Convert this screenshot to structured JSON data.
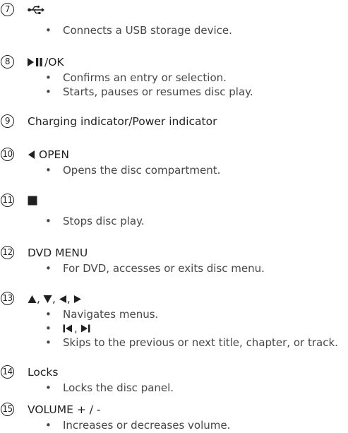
{
  "items": [
    {
      "number": "7",
      "heading_icon": "usb-icon",
      "bullets": [
        {
          "marker": "•",
          "text": "Connects a USB storage device."
        }
      ]
    },
    {
      "number": "8",
      "heading_icon": "play-pause-icon",
      "heading_text": "/OK",
      "bullets": [
        {
          "marker": "•",
          "text": "Confirms an entry or selection."
        },
        {
          "marker": "•",
          "text": "Starts, pauses or resumes disc play."
        }
      ]
    },
    {
      "number": "9",
      "heading_text": "Charging indicator/Power indicator"
    },
    {
      "number": "10",
      "heading_icon": "eject-left-triangle-icon",
      "heading_text": "OPEN",
      "bullets": [
        {
          "marker": "•",
          "text": "Opens the disc compartment."
        }
      ]
    },
    {
      "number": "11",
      "heading_icon": "stop-square-icon",
      "bullets": [
        {
          "marker": "•",
          "text": "Stops disc play."
        }
      ]
    },
    {
      "number": "12",
      "heading_text": "DVD MENU",
      "bullets": [
        {
          "marker": "•",
          "text": "For DVD, accesses or exits disc menu."
        }
      ]
    },
    {
      "number": "13",
      "heading_sep": ",",
      "heading_icons": [
        "up-triangle-icon",
        "down-triangle-icon",
        "left-triangle-icon",
        "right-triangle-icon"
      ],
      "bullets": [
        {
          "marker": "•",
          "text": "Navigates menus."
        },
        {
          "marker": "•",
          "icons": [
            "skip-previous-icon",
            "skip-next-icon"
          ],
          "sep": ","
        },
        {
          "marker": "•",
          "text": "Skips to the previous or next title, chapter, or track."
        }
      ]
    },
    {
      "number": "14",
      "heading_text": "Locks",
      "bullets": [
        {
          "marker": "•",
          "text": "Locks the disc panel."
        }
      ]
    },
    {
      "number": "15",
      "heading_text": "VOLUME + / -",
      "bullets": [
        {
          "marker": "•",
          "text": "Increases or decreases volume."
        }
      ]
    }
  ],
  "colors": {
    "text": "#231f20",
    "body_text": "#4a4647"
  }
}
